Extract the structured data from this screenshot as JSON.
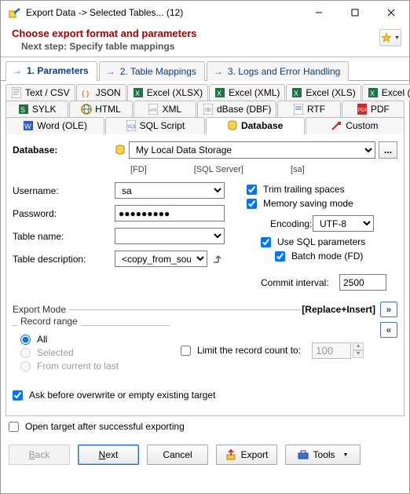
{
  "window": {
    "title": "Export Data -> Selected Tables... (12)"
  },
  "header": {
    "title": "Choose export format and parameters",
    "subtitle": "Next step: Specify table mappings"
  },
  "wizardTabs": {
    "t1": "1. Parameters",
    "t2": "2. Table Mappings",
    "t3": "3. Logs and Error Handling"
  },
  "formats": {
    "textcsv": "Text / CSV",
    "json": "JSON",
    "xlsx": "Excel (XLSX)",
    "excelxml": "Excel (XML)",
    "excelxls": "Excel (XLS)",
    "excelole": "Excel (OLE)",
    "sylk": "SYLK",
    "html": "HTML",
    "xml": "XML",
    "dbase": "dBase (DBF)",
    "rtf": "RTF",
    "pdf": "PDF",
    "wordole": "Word (OLE)",
    "sqlscript": "SQL Script",
    "database": "Database",
    "custom": "Custom"
  },
  "db": {
    "label": "Database:",
    "value": "My Local Data Storage",
    "ellipsis": "...",
    "sub1": "[FD]",
    "sub2": "[SQL Server]",
    "sub3": "[sa]"
  },
  "left": {
    "usernameLabel": "Username:",
    "usernameValue": "sa",
    "passwordLabel": "Password:",
    "passwordValue": "●●●●●●●●●",
    "tablenameLabel": "Table name:",
    "tablenameValue": "",
    "tabledescLabel": "Table description:",
    "tabledescValue": "<copy_from_source>"
  },
  "right": {
    "trim": "Trim trailing spaces",
    "mem": "Memory saving mode",
    "encodingLabel": "Encoding:",
    "encodingValue": "UTF-8",
    "useSql": "Use SQL parameters",
    "batch": "Batch mode (FD)",
    "commitLabel": "Commit interval:",
    "commitValue": "2500"
  },
  "exportMode": {
    "title": "Export Mode",
    "value": "[Replace+Insert]",
    "expand": "»",
    "collapse": "«"
  },
  "recordRange": {
    "title": "Record range",
    "all": "All",
    "selected": "Selected",
    "fromCurrent": "From current to last",
    "limitLabel": "Limit the record count to:",
    "limitValue": "100"
  },
  "ask": "Ask before overwrite or empty existing target",
  "openAfter": "Open target after successful exporting",
  "buttons": {
    "back": "ack",
    "backAccel": "B",
    "next": "ext",
    "nextAccel": "N",
    "cancel": "Cancel",
    "export": "Export",
    "tools": "Tools"
  }
}
